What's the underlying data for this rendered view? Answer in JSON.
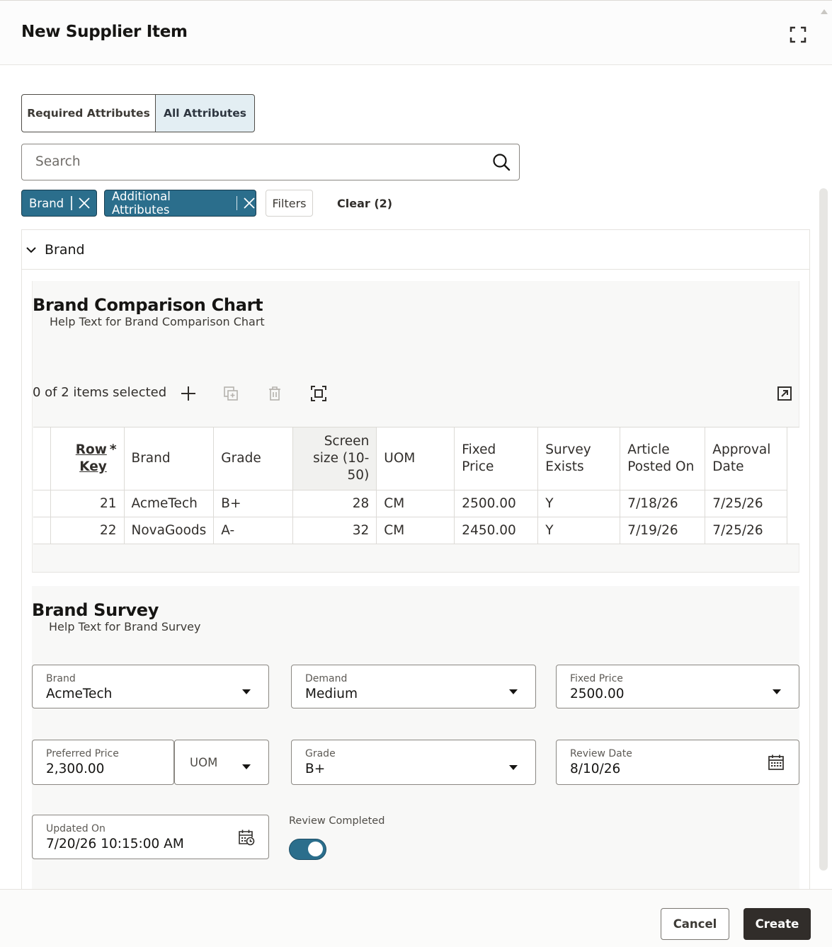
{
  "dialog": {
    "title": "New Supplier Item"
  },
  "tabs": [
    {
      "label": "Required Attributes",
      "selected": false
    },
    {
      "label": "All Attributes",
      "selected": true
    }
  ],
  "search": {
    "placeholder": "Search"
  },
  "filter_chips": [
    {
      "label": "Brand"
    },
    {
      "label": "Additional Attributes"
    }
  ],
  "filters_label": "Filters",
  "clear_label": "Clear (2)",
  "section": {
    "title": "Brand",
    "expanded": true
  },
  "comparison_chart": {
    "title": "Brand Comparison Chart",
    "help": "Help Text for Brand Comparison Chart",
    "selection_status": "0 of 2 items selected",
    "columns": {
      "row_key_line1": "Row",
      "row_key_line2": "Key",
      "required_mark": "*",
      "brand": "Brand",
      "grade": "Grade",
      "screen_size_l1": "Screen",
      "screen_size_l2": "size (10-",
      "screen_size_l3": "50)",
      "uom": "UOM",
      "fixed_price_l1": "Fixed",
      "fixed_price_l2": "Price",
      "survey_exists_l1": "Survey",
      "survey_exists_l2": "Exists",
      "article_posted_l1": "Article",
      "article_posted_l2": "Posted On",
      "approval_date_l1": "Approval",
      "approval_date_l2": "Date"
    },
    "rows": [
      {
        "row_key": "21",
        "brand": "AcmeTech",
        "grade": "B+",
        "screen_size": "28",
        "uom": "CM",
        "fixed_price": "2500.00",
        "survey_exists": "Y",
        "article_posted_on": "7/18/26",
        "approval_date": "7/25/26"
      },
      {
        "row_key": "22",
        "brand": "NovaGoods",
        "grade": "A-",
        "screen_size": "32",
        "uom": "CM",
        "fixed_price": "2450.00",
        "survey_exists": "Y",
        "article_posted_on": "7/19/26",
        "approval_date": "7/25/26"
      }
    ]
  },
  "survey": {
    "title": "Brand Survey",
    "help": "Help Text for Brand Survey",
    "fields": {
      "brand": {
        "label": "Brand",
        "value": "AcmeTech"
      },
      "demand": {
        "label": "Demand",
        "value": "Medium"
      },
      "fixed_price": {
        "label": "Fixed Price",
        "value": "2500.00"
      },
      "preferred_price": {
        "label": "Preferred Price",
        "value": "2,300.00"
      },
      "uom": {
        "placeholder": "UOM"
      },
      "grade": {
        "label": "Grade",
        "value": "B+"
      },
      "review_date": {
        "label": "Review Date",
        "value": "8/10/26"
      },
      "updated_on": {
        "label": "Updated On",
        "value": "7/20/26 10:15:00 AM"
      },
      "review_completed": {
        "label": "Review Completed",
        "on": true
      }
    }
  },
  "footer": {
    "cancel_label": "Cancel",
    "create_label": "Create"
  },
  "colors": {
    "accent": "#2b6e8c",
    "primary_button": "#312d2a",
    "selected_tab_bg": "#e3eef3"
  }
}
